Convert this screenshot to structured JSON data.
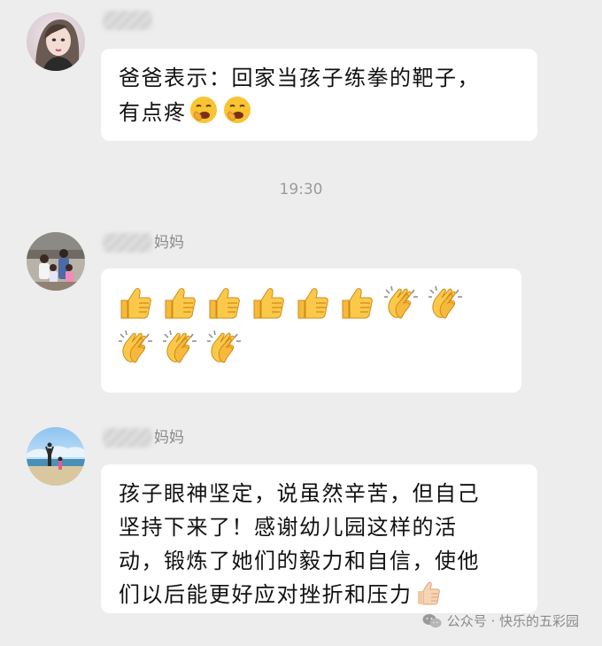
{
  "messages": [
    {
      "sender": "",
      "text": "爸爸表示：回家当孩子练拳的靶子，\n有点疼",
      "trailing_emojis": [
        "yawning-face-icon",
        "yawning-face-icon"
      ]
    },
    {
      "timestamp": "19:30"
    },
    {
      "sender": "妈妈",
      "emojis": [
        "thumbs-up-icon",
        "thumbs-up-icon",
        "thumbs-up-icon",
        "thumbs-up-icon",
        "thumbs-up-icon",
        "thumbs-up-icon",
        "clapping-hands-icon",
        "clapping-hands-icon",
        "clapping-hands-icon",
        "clapping-hands-icon",
        "clapping-hands-icon"
      ]
    },
    {
      "sender": "妈妈",
      "text": "孩子眼神坚定，说虽然辛苦，但自己\n坚持下来了！感谢幼儿园这样的活\n动，锻炼了她们的毅力和自信，使他\n们以后能更好应对挫折和压力",
      "trailing_emojis": [
        "thumbs-up-light-icon"
      ]
    }
  ],
  "watermark": {
    "text": "公众号 · 快乐的五彩园",
    "icon": "wechat-icon"
  },
  "colors": {
    "background": "#ededed",
    "bubble": "#ffffff",
    "text": "#111111",
    "meta": "#8a8a8a"
  }
}
